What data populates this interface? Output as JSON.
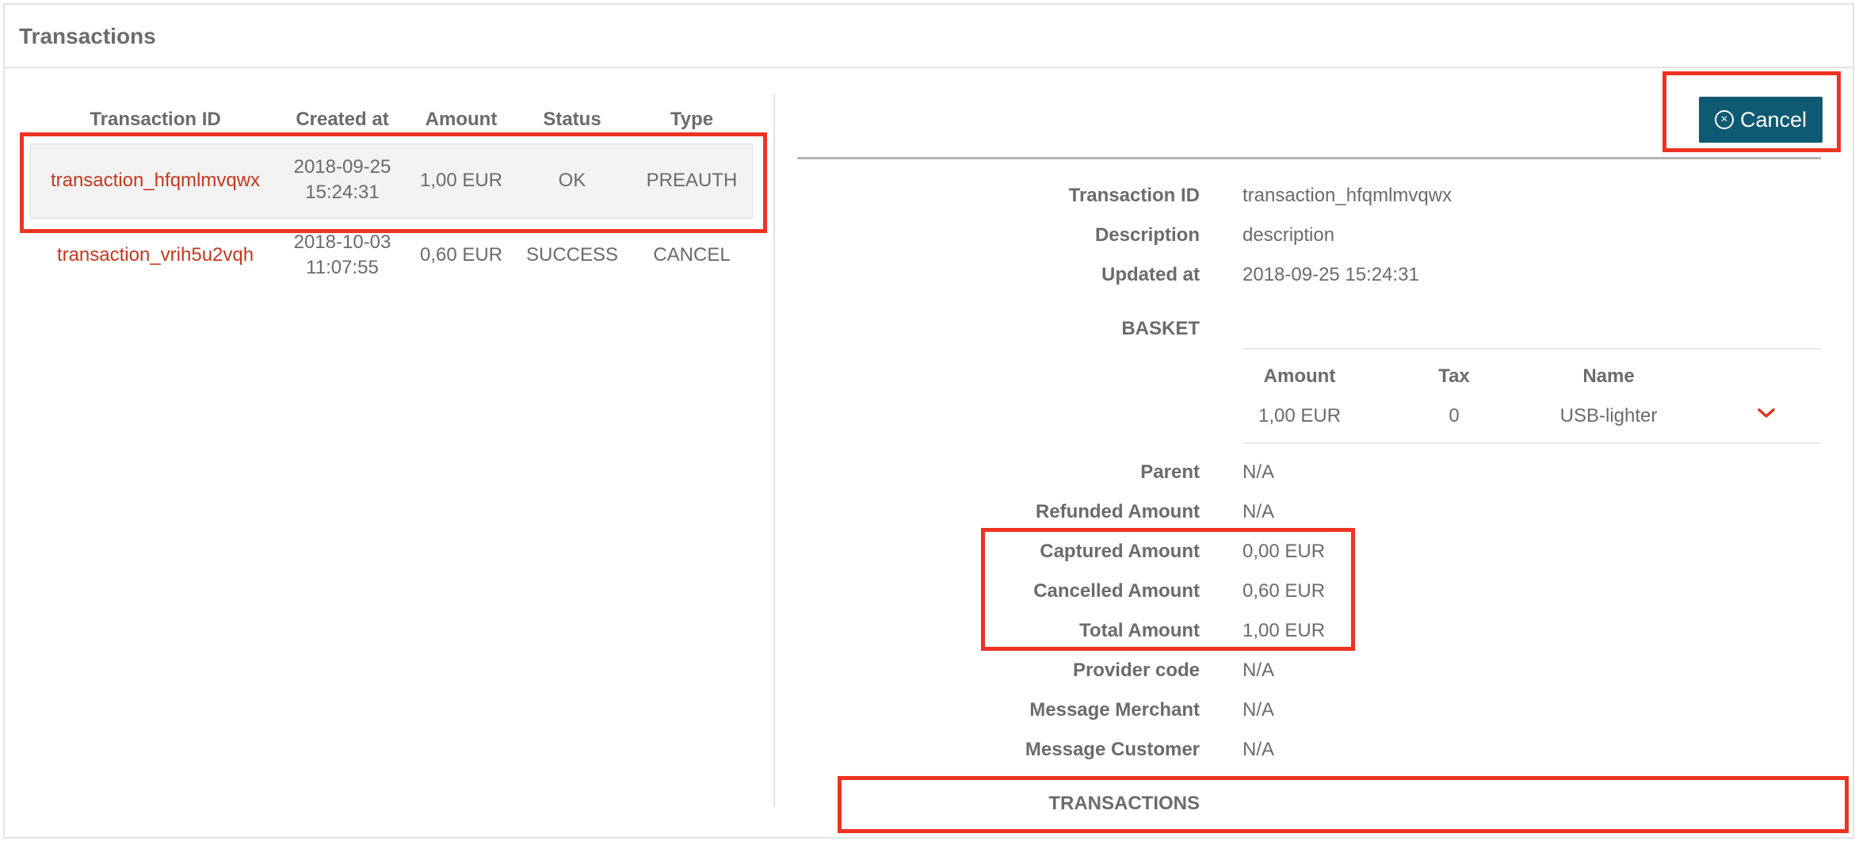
{
  "header": {
    "title": "Transactions"
  },
  "list": {
    "columns": [
      "Transaction ID",
      "Created at",
      "Amount",
      "Status",
      "Type"
    ],
    "rows": [
      {
        "id": "transaction_hfqmlmvqwx",
        "date": "2018-09-25",
        "time": "15:24:31",
        "amount": "1,00 EUR",
        "status": "OK",
        "type": "PREAUTH"
      },
      {
        "id": "transaction_vrih5u2vqh",
        "date": "2018-10-03",
        "time": "11:07:55",
        "amount": "0,60 EUR",
        "status": "SUCCESS",
        "type": "CANCEL"
      }
    ]
  },
  "detail": {
    "cancel_label": "Cancel",
    "cancel_icon": "circle-x-icon",
    "fields": {
      "transaction_id": {
        "label": "Transaction ID",
        "value": "transaction_hfqmlmvqwx"
      },
      "description": {
        "label": "Description",
        "value": "description"
      },
      "updated_at": {
        "label": "Updated at",
        "value": "2018-09-25 15:24:31"
      },
      "parent": {
        "label": "Parent",
        "value": "N/A"
      },
      "refunded": {
        "label": "Refunded Amount",
        "value": "N/A"
      },
      "captured": {
        "label": "Captured Amount",
        "value": "0,00 EUR"
      },
      "cancelled": {
        "label": "Cancelled Amount",
        "value": "0,60 EUR"
      },
      "total": {
        "label": "Total Amount",
        "value": "1,00 EUR"
      },
      "provider_code": {
        "label": "Provider code",
        "value": "N/A"
      },
      "msg_merchant": {
        "label": "Message Merchant",
        "value": "N/A"
      },
      "msg_customer": {
        "label": "Message Customer",
        "value": "N/A"
      }
    },
    "basket": {
      "label": "BASKET",
      "columns": [
        "Amount",
        "Tax",
        "Name"
      ],
      "item": {
        "amount": "1,00 EUR",
        "tax": "0",
        "name": "USB-lighter"
      },
      "expand_icon": "chevron-down-icon"
    },
    "transactions_label": "TRANSACTIONS"
  },
  "colors": {
    "accent": "#0e5a72",
    "link": "#c8361b",
    "highlight": "#ee3322"
  }
}
